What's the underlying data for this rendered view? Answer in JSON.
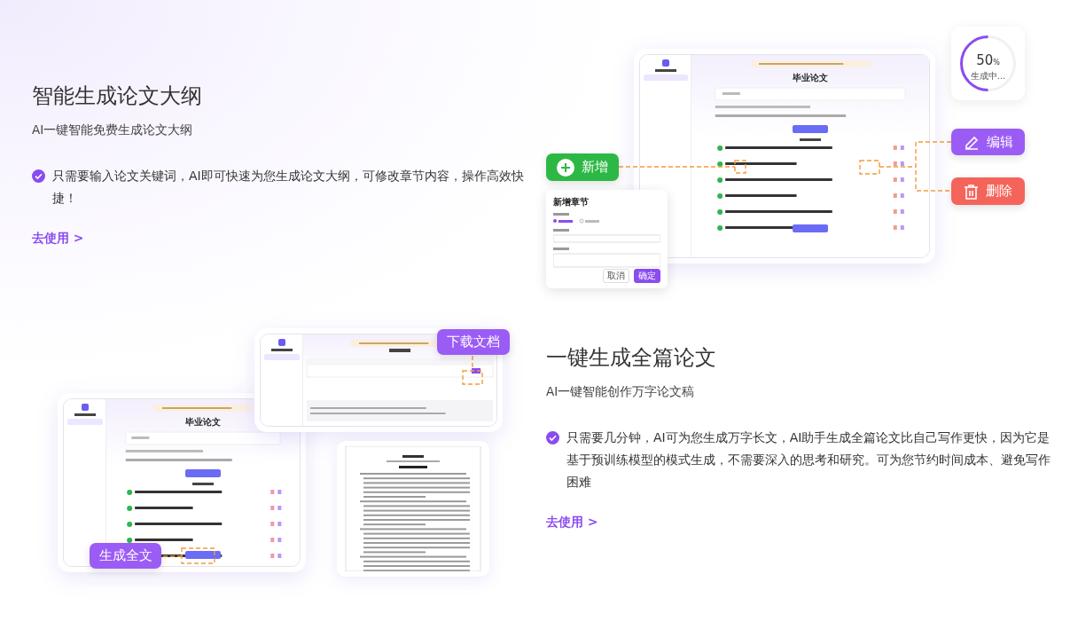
{
  "sections": [
    {
      "kind": "outline",
      "title": "智能生成论文大纲",
      "subtitle": "AI一键智能免费生成论文大纲",
      "features": [
        "只需要输入论文关键词，AI即可快速为您生成论文大纲，可修改章节内容，操作高效快捷！"
      ],
      "link": "去使用 >",
      "illustration": {
        "screen_title": "毕业论文",
        "progress": {
          "value": "50",
          "unit": "%",
          "status": "生成中...",
          "level": 0.5
        },
        "callouts": [
          {
            "kind": "add",
            "label": "新增",
            "color": "#2db845"
          },
          {
            "kind": "edit",
            "label": "编辑",
            "color": "#9b5cf5"
          },
          {
            "kind": "delete",
            "label": "删除",
            "color": "#f5645a"
          }
        ],
        "dialog": {
          "title": "新增章节",
          "buttons": [
            "取消",
            "确定"
          ]
        }
      }
    },
    {
      "kind": "fulltext",
      "title": "一键生成全篇论文",
      "subtitle": "AI一键智能创作万字论文稿",
      "features": [
        "只需要几分钟，AI可为您生成万字长文，AI助手生成全篇论文比自己写作更快，因为它是基于预训练模型的模式生成，不需要深入的思考和研究。可为您节约时间成本、避免写作困难"
      ],
      "link": "去使用 >",
      "illustration": {
        "screen_title": "毕业论文",
        "callouts": [
          {
            "kind": "download",
            "label": "下载文档",
            "color": "#9b5cf5"
          },
          {
            "kind": "generate",
            "label": "生成全文",
            "color": "#9b5cf5"
          }
        ]
      }
    }
  ]
}
